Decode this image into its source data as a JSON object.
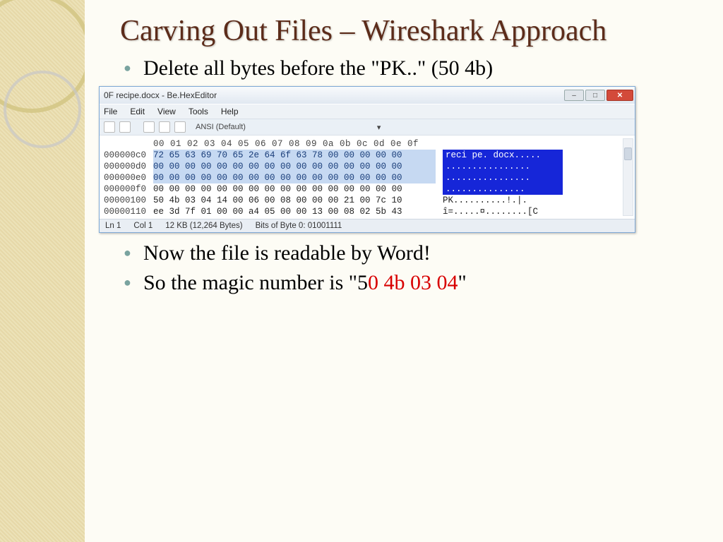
{
  "title": "Carving Out Files – Wireshark Approach",
  "bullets": {
    "b1": "Delete all bytes before the \"PK..\" (50 4b)",
    "b2": "Now the file is readable by Word!",
    "b3a": "So the magic number is \"5",
    "b3b": "0 4b 03 04",
    "b3c": "\""
  },
  "win": {
    "title": "0F  recipe.docx - Be.HexEditor",
    "menus": {
      "m1": "File",
      "m2": "Edit",
      "m3": "View",
      "m4": "Tools",
      "m5": "Help"
    },
    "encoding": "ANSI (Default)",
    "colheader": "00 01 02 03 04 05 06 07 08 09 0a 0b 0c 0d 0e 0f",
    "rows": [
      {
        "off": "000000c0",
        "bytes_sel": "72 65 63 69 70 65 2e 64 6f 63 78 00 00 00 00 00",
        "bytes_plain": "",
        "ascii": "reci pe. docx.....",
        "sel": true
      },
      {
        "off": "000000d0",
        "bytes_sel": "00 00 00 00 00 00 00 00 00 00 00 00 00 00 00 00",
        "bytes_plain": "",
        "ascii": "................",
        "sel": true
      },
      {
        "off": "000000e0",
        "bytes_sel": "00 00 00 00 00 00 00 00 00 00 00 00 00 00 00 00",
        "bytes_plain": "",
        "ascii": "................",
        "sel": true
      },
      {
        "off": "000000f0",
        "bytes_sel": "00 00 00 00 00 00 00 00 00 00 00 00 00 00 00",
        "bytes_plain": " 00",
        "ascii": "...............",
        "sel": true
      },
      {
        "off": "00000100",
        "bytes_sel": "",
        "bytes_plain": "50 4b 03 04 14 00 06 00 08 00 00 00 21 00 7c 10",
        "ascii": "PK..........!.|.",
        "sel": false
      },
      {
        "off": "00000110",
        "bytes_sel": "",
        "bytes_plain": "ee 3d 7f 01 00 00 a4 05 00 00 13 00 08 02 5b 43",
        "ascii": "î=.....¤........[C",
        "sel": false
      }
    ],
    "status": {
      "s1": "Ln 1",
      "s2": "Col 1",
      "s3": "12 KB (12,264 Bytes)",
      "s4": "Bits of Byte 0: 01001111"
    }
  }
}
